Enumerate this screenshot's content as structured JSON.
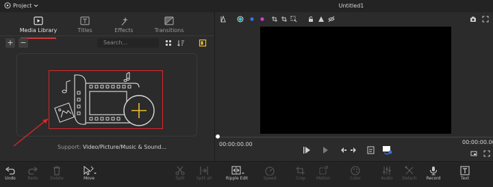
{
  "titlebar": {
    "project_label": "Project",
    "window_title": "Untitled1"
  },
  "tabs": [
    {
      "label": "Media Library",
      "active": true,
      "icon": "media-library-icon"
    },
    {
      "label": "Titles",
      "active": false,
      "icon": "titles-icon"
    },
    {
      "label": "Effects",
      "active": false,
      "icon": "effects-icon"
    },
    {
      "label": "Transitions",
      "active": false,
      "icon": "transitions-icon"
    }
  ],
  "library": {
    "add_label": "+",
    "remove_label": "−",
    "search_placeholder": "Search...",
    "support_prefix": "Support:",
    "support_formats": "Video/Picture/Music & Sound..."
  },
  "preview": {
    "timecode_current": "00:00:00.00",
    "timecode_total": "00:00:00.00",
    "color_dots": [
      "#2ec4c9",
      "#3b6ee6",
      "#d23bd2",
      "#e0b83b"
    ]
  },
  "toolbar": {
    "items": [
      {
        "label": "Undo",
        "enabled": true
      },
      {
        "label": "Redo",
        "enabled": false
      },
      {
        "label": "Delete",
        "enabled": false
      },
      {
        "label": "Move",
        "enabled": true
      },
      {
        "label": "Split",
        "enabled": false
      },
      {
        "label": "Split all",
        "enabled": false
      },
      {
        "label": "Ripple Edit",
        "enabled": true
      },
      {
        "label": "Speed",
        "enabled": false
      },
      {
        "label": "Crop",
        "enabled": false
      },
      {
        "label": "Motion",
        "enabled": false
      },
      {
        "label": "Color",
        "enabled": false
      },
      {
        "label": "Audio",
        "enabled": false
      },
      {
        "label": "Detach",
        "enabled": false
      },
      {
        "label": "Record",
        "enabled": true
      },
      {
        "label": "Text",
        "enabled": true
      }
    ]
  },
  "colors": {
    "accent_red": "#e0262b",
    "highlight_yellow": "#f0c230"
  }
}
